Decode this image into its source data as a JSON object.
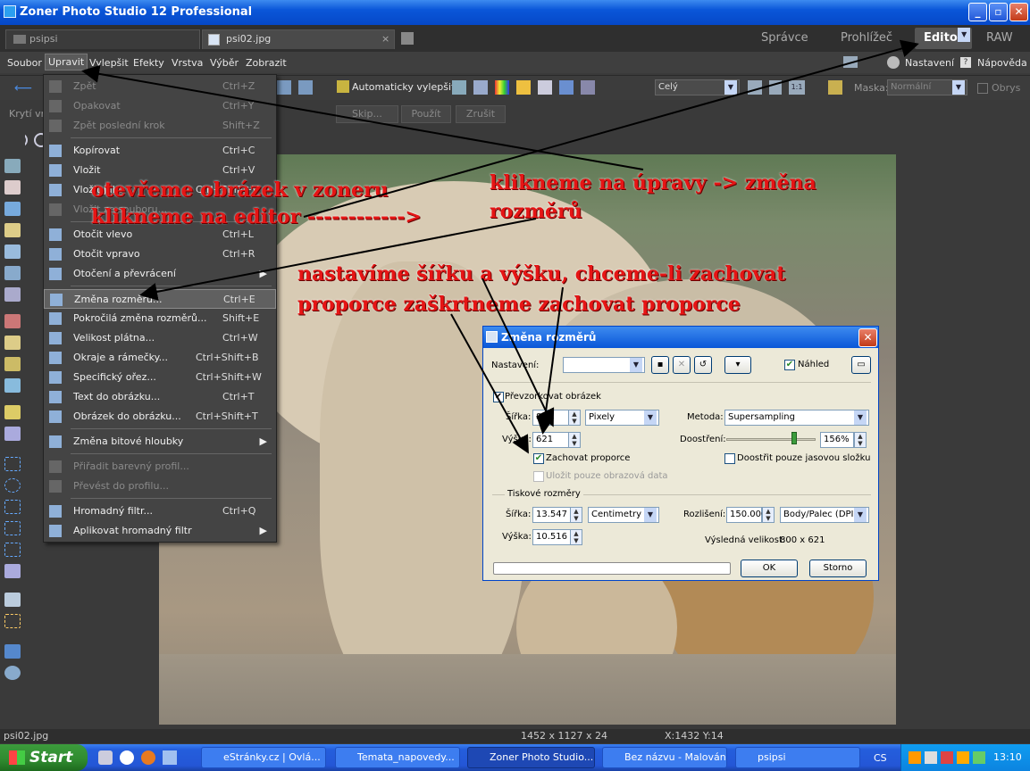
{
  "window": {
    "title": "Zoner Photo Studio 12 Professional",
    "min": "_",
    "max": "▫",
    "close": "✕"
  },
  "tabs": {
    "doc1": "psipsi",
    "doc2": "psi02.jpg",
    "doc2_close": "×",
    "modules": [
      "Správce",
      "Prohlížeč",
      "Editor",
      "RAW"
    ]
  },
  "menu": {
    "items": [
      "Soubor",
      "Upravit",
      "Vylepšit",
      "Efekty",
      "Vrstva",
      "Výběr",
      "Zobrazit"
    ],
    "settings": "Nastavení",
    "help": "Nápověda"
  },
  "toolbar": {
    "auto_enhance": "Automaticky vylepšit",
    "zoom_select": "Celý",
    "mask_label": "Maska:",
    "mask_value": "Normální",
    "outline": "Obrys"
  },
  "toolbar2": {
    "opacity_label": "Krytí vr",
    "step": "Skip...",
    "apply": "Použít",
    "cancel": "Zrušit"
  },
  "dropdown": [
    {
      "label": "Zpět",
      "sc": "Ctrl+Z",
      "dis": true
    },
    {
      "label": "Opakovat",
      "sc": "Ctrl+Y",
      "dis": true
    },
    {
      "label": "Zpět poslední krok",
      "sc": "Shift+Z",
      "dis": true
    },
    {
      "label": "Kopírovat",
      "sc": "Ctrl+C",
      "dis": false
    },
    {
      "label": "Vložit",
      "sc": "Ctrl+V",
      "dis": false
    },
    {
      "label": "Vložit jako",
      "sc": "Ctrl+Shift+V",
      "dis": false
    },
    {
      "label": "Vložit ze souboru...",
      "sc": "",
      "dis": true
    },
    {
      "label": "Otočit vlevo",
      "sc": "Ctrl+L",
      "dis": false
    },
    {
      "label": "Otočit vpravo",
      "sc": "Ctrl+R",
      "dis": false
    },
    {
      "label": "Otočení a převrácení",
      "sc": "▶",
      "dis": false
    },
    {
      "label": "Změna rozměrů...",
      "sc": "Ctrl+E",
      "dis": false
    },
    {
      "label": "Pokročilá změna rozměrů...",
      "sc": "Shift+E",
      "dis": false
    },
    {
      "label": "Velikost plátna...",
      "sc": "Ctrl+W",
      "dis": false
    },
    {
      "label": "Okraje a rámečky...",
      "sc": "Ctrl+Shift+B",
      "dis": false
    },
    {
      "label": "Specifický ořez...",
      "sc": "Ctrl+Shift+W",
      "dis": false
    },
    {
      "label": "Text do obrázku...",
      "sc": "Ctrl+T",
      "dis": false
    },
    {
      "label": "Obrázek do obrázku...",
      "sc": "Ctrl+Shift+T",
      "dis": false
    },
    {
      "label": "Změna bitové hloubky",
      "sc": "▶",
      "dis": false
    },
    {
      "label": "Přiřadit barevný profil...",
      "sc": "",
      "dis": true
    },
    {
      "label": "Převést do profilu...",
      "sc": "",
      "dis": true
    },
    {
      "label": "Hromadný filtr...",
      "sc": "Ctrl+Q",
      "dis": false
    },
    {
      "label": "Aplikovat hromadný filtr",
      "sc": "▶",
      "dis": false
    }
  ],
  "dialog": {
    "title": "Změna rozměrů",
    "settings_label": "Nastavení:",
    "preview": "Náhled",
    "resample": "Převzorkovat obrázek",
    "width_label": "Šířka:",
    "width": "800",
    "height_label": "Výška:",
    "height": "621",
    "unit": "Pixely",
    "method_label": "Metoda:",
    "method": "Supersampling",
    "sharpen_label": "Doostření:",
    "sharpen": "156%",
    "keep_ratio": "Zachovat proporce",
    "sharpen_luma": "Doostřit pouze jasovou složku",
    "save_only": "Uložit pouze obrazová data",
    "print_group": "Tiskové rozměry",
    "print_width": "13.547",
    "print_height": "10.516",
    "print_unit": "Centimetry",
    "res_label": "Rozlišení:",
    "res": "150.000",
    "res_unit": "Body/Palec (DPI)",
    "result_label": "Výsledná velikost:",
    "result": "800 x 621",
    "ok": "OK",
    "cancel": "Storno"
  },
  "annotations": {
    "a1": "otevřeme obrázek v zoneru",
    "a2": "klikneme na editor ------------>",
    "a3": "klikneme na úpravy -> změna",
    "a3b": "rozměrů",
    "a4": "nastavíme šířku a výšku, chceme-li zachovat",
    "a4b": "proporce zaškrtneme zachovat proporce"
  },
  "status": {
    "file": "psi02.jpg",
    "dims": "1452 x 1127 x 24",
    "coords": "X:1432  Y:14"
  },
  "taskbar": {
    "start": "Start",
    "items": [
      "eStránky.cz | Ovlá...",
      "Temata_napovedy...",
      "Zoner Photo Studio...",
      "Bez názvu - Malování",
      "psipsi"
    ],
    "lang": "CS",
    "time": "13:10"
  }
}
